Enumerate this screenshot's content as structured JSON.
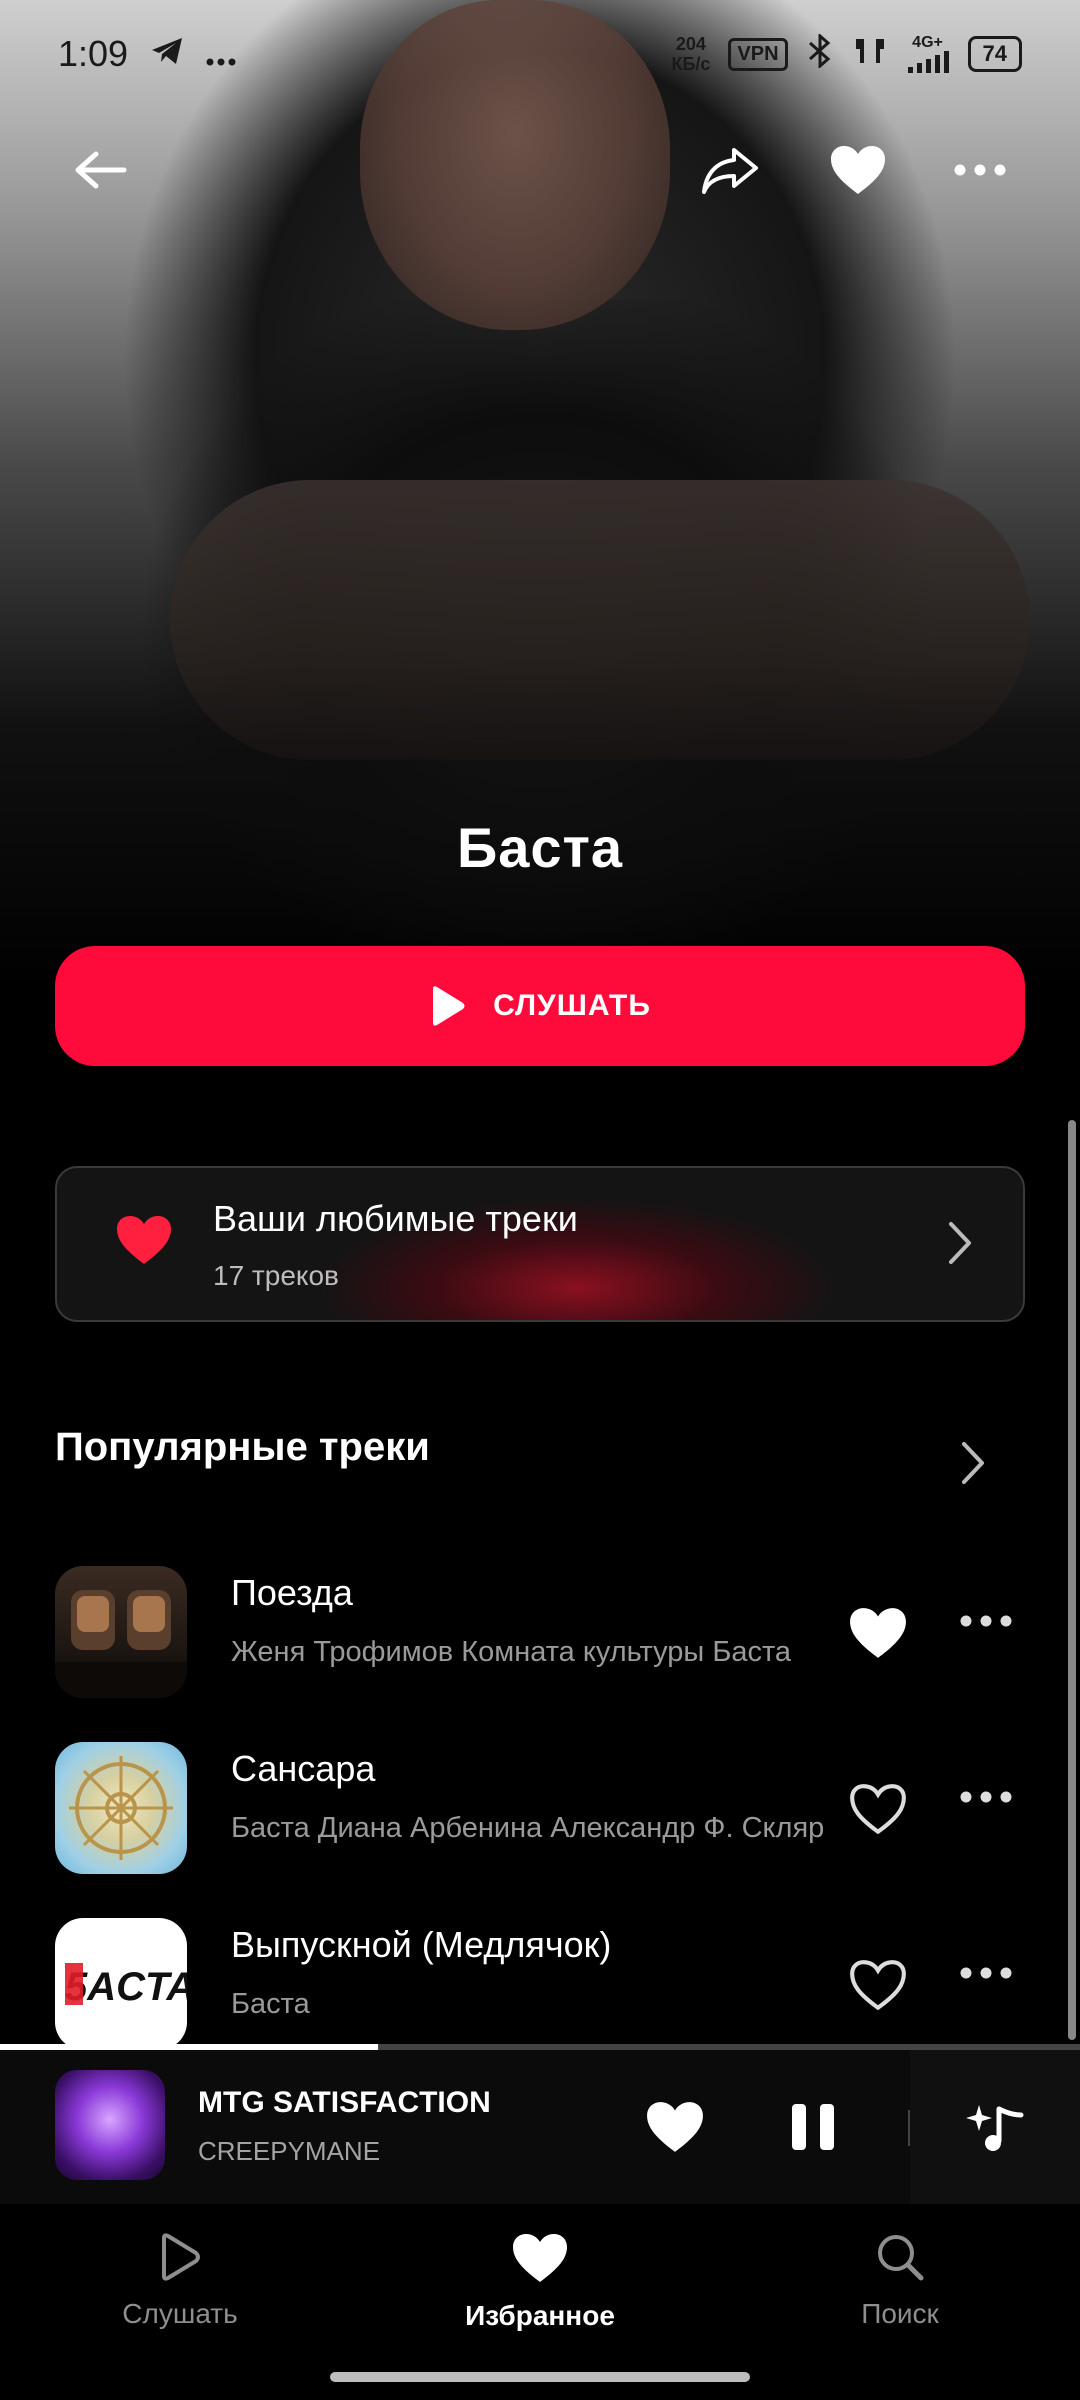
{
  "status_bar": {
    "time": "1:09",
    "speed_value": "204",
    "speed_unit": "КБ/с",
    "vpn": "VPN",
    "network": "4G+",
    "battery": "74"
  },
  "artist": {
    "name": "Баста"
  },
  "play_button": {
    "label": "СЛУШАТЬ"
  },
  "favorites_card": {
    "title": "Ваши любимые треки",
    "subtitle": "17 треков"
  },
  "popular": {
    "title": "Популярные треки",
    "tracks": [
      {
        "name": "Поезда",
        "artists": "Женя Трофимов Комната культуры Баста",
        "liked": true
      },
      {
        "name": "Сансара",
        "artists": "Баста Диана Арбенина Александр Ф. Скляр",
        "liked": false
      },
      {
        "name": "Выпускной (Медлячок)",
        "artists": "Баста",
        "liked": false
      }
    ]
  },
  "cover3_text": "5ACTA",
  "now_playing": {
    "title": "MTG SATISFACTION",
    "artist": "CREEPYMANE",
    "progress": 0.35,
    "liked": true
  },
  "nav": {
    "items": [
      {
        "label": "Слушать",
        "icon": "play-icon"
      },
      {
        "label": "Избранное",
        "icon": "heart-icon",
        "active": true
      },
      {
        "label": "Поиск",
        "icon": "search-icon"
      }
    ]
  },
  "colors": {
    "accent": "#fe0b3b",
    "background": "#000000"
  }
}
